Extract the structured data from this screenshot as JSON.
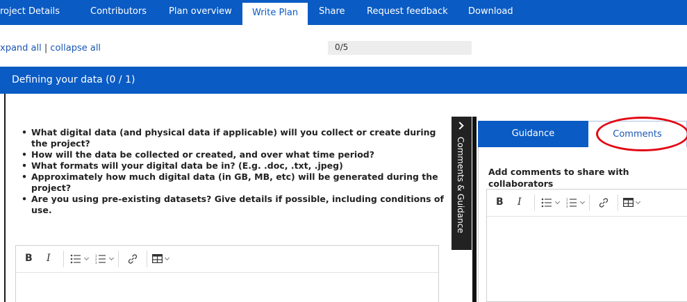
{
  "top_tabs": [
    {
      "label": "roject Details",
      "active": false
    },
    {
      "label": "Contributors",
      "active": false
    },
    {
      "label": "Plan overview",
      "active": false
    },
    {
      "label": "Write Plan",
      "active": true
    },
    {
      "label": "Share",
      "active": false
    },
    {
      "label": "Request feedback",
      "active": false
    },
    {
      "label": "Download",
      "active": false
    }
  ],
  "controls": {
    "expand_all": "xpand all",
    "separator": "|",
    "collapse_all": "collapse all"
  },
  "progress": {
    "text": "0/5",
    "value": 0
  },
  "section": {
    "title": "Defining your data (0 / 1)"
  },
  "questions": [
    "What digital data (and physical data if applicable) will you collect or create during the project?",
    "How will the data be collected or created, and over what time period?",
    "What formats will your digital data be in? (E.g. .doc, .txt, .jpeg)",
    "Approximately how much digital data (in GB, MB, etc) will be generated during the project?",
    "Are you using pre-existing datasets? Give details if possible, including conditions of use."
  ],
  "editor_toolbar": {
    "bold": "B",
    "italic": "I",
    "icons": [
      "bullet-list-icon",
      "numbered-list-icon",
      "link-icon",
      "table-icon"
    ]
  },
  "side_tab": {
    "label": "Comments & Guidance",
    "icon": "chevron-right-icon"
  },
  "panel": {
    "tabs": {
      "guidance": "Guidance",
      "comments": "Comments"
    },
    "heading": "Add comments to share with collaborators"
  },
  "colors": {
    "brand_blue": "#0a5bc4",
    "highlight_red": "#e30613"
  }
}
